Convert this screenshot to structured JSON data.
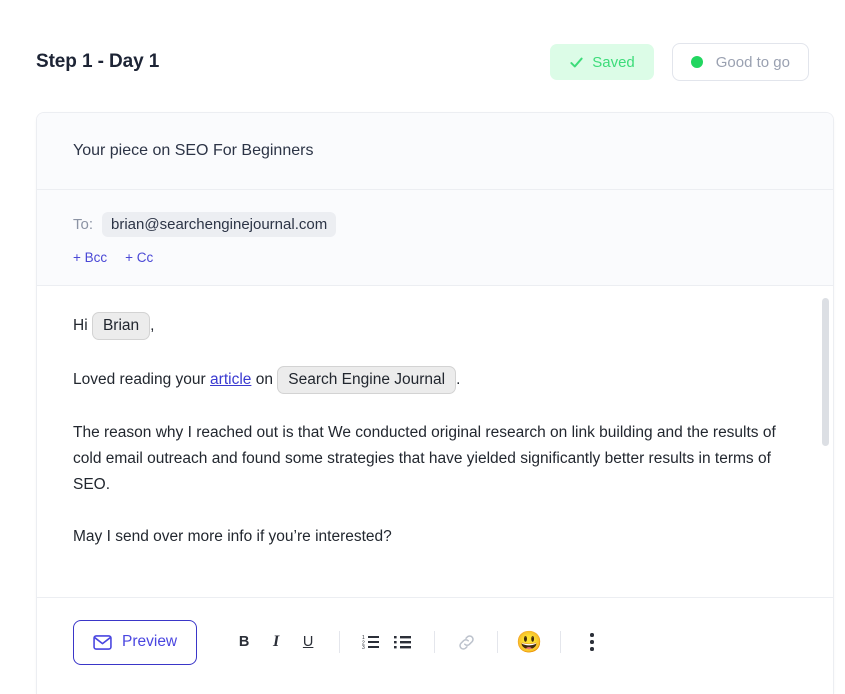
{
  "header": {
    "title": "Step 1 - Day 1",
    "saved_label": "Saved",
    "saved_icon": "check-icon",
    "status_label": "Good to go",
    "status_icon": "status-dot-icon",
    "saved_bg_color": "#dcfce7",
    "saved_text_color": "#3ddc7a",
    "status_dot_color": "#22d660"
  },
  "email": {
    "subject": "Your piece on SEO For Beginners",
    "to_label": "To:",
    "to_value": "brian@searchenginejournal.com",
    "bcc_label": "+ Bcc",
    "cc_label": "+ Cc",
    "body": {
      "greeting_prefix": "Hi",
      "greeting_tag": "Brian",
      "greeting_suffix": ",",
      "line2_prefix": "Loved reading your",
      "line2_link": "article",
      "line2_mid": "on",
      "line2_tag": "Search Engine Journal",
      "line2_suffix": ".",
      "paragraph1": "The reason why I reached out is that We conducted original research on link building and the results of cold email outreach and found some strategies that have yielded significantly better results in terms of SEO.",
      "paragraph2": "May I send over more info if you’re interested?"
    }
  },
  "toolbar": {
    "preview_label": "Preview",
    "preview_icon": "envelope-icon",
    "bold_label": "B",
    "italic_label": "I",
    "underline_label": "U",
    "ordered_list_icon": "ordered-list-icon",
    "bullet_list_icon": "bullet-list-icon",
    "link_icon": "link-icon",
    "emoji_icon": "😃",
    "more_icon": "vertical-dots-icon",
    "accent_color": "#4a46e0"
  }
}
